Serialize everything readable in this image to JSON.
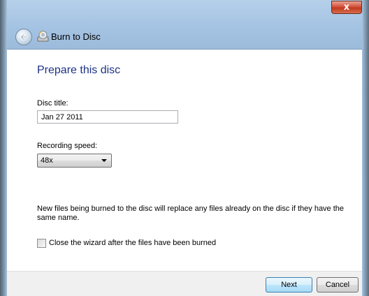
{
  "window": {
    "title": "Burn to Disc",
    "close_label": "x",
    "icons": {
      "back": "back-arrow-icon",
      "app": "disc-burn-icon",
      "close": "close-icon"
    }
  },
  "main": {
    "heading": "Prepare this disc",
    "disc_title": {
      "label": "Disc title:",
      "value": "Jan 27 2011"
    },
    "recording_speed": {
      "label": "Recording speed:",
      "selected": "48x"
    },
    "info": "New files being burned to the disc will replace any files already on the disc if they have the same name.",
    "close_wizard": {
      "label": "Close the wizard after the files have been burned",
      "checked": false
    }
  },
  "footer": {
    "next_label": "Next",
    "cancel_label": "Cancel"
  }
}
